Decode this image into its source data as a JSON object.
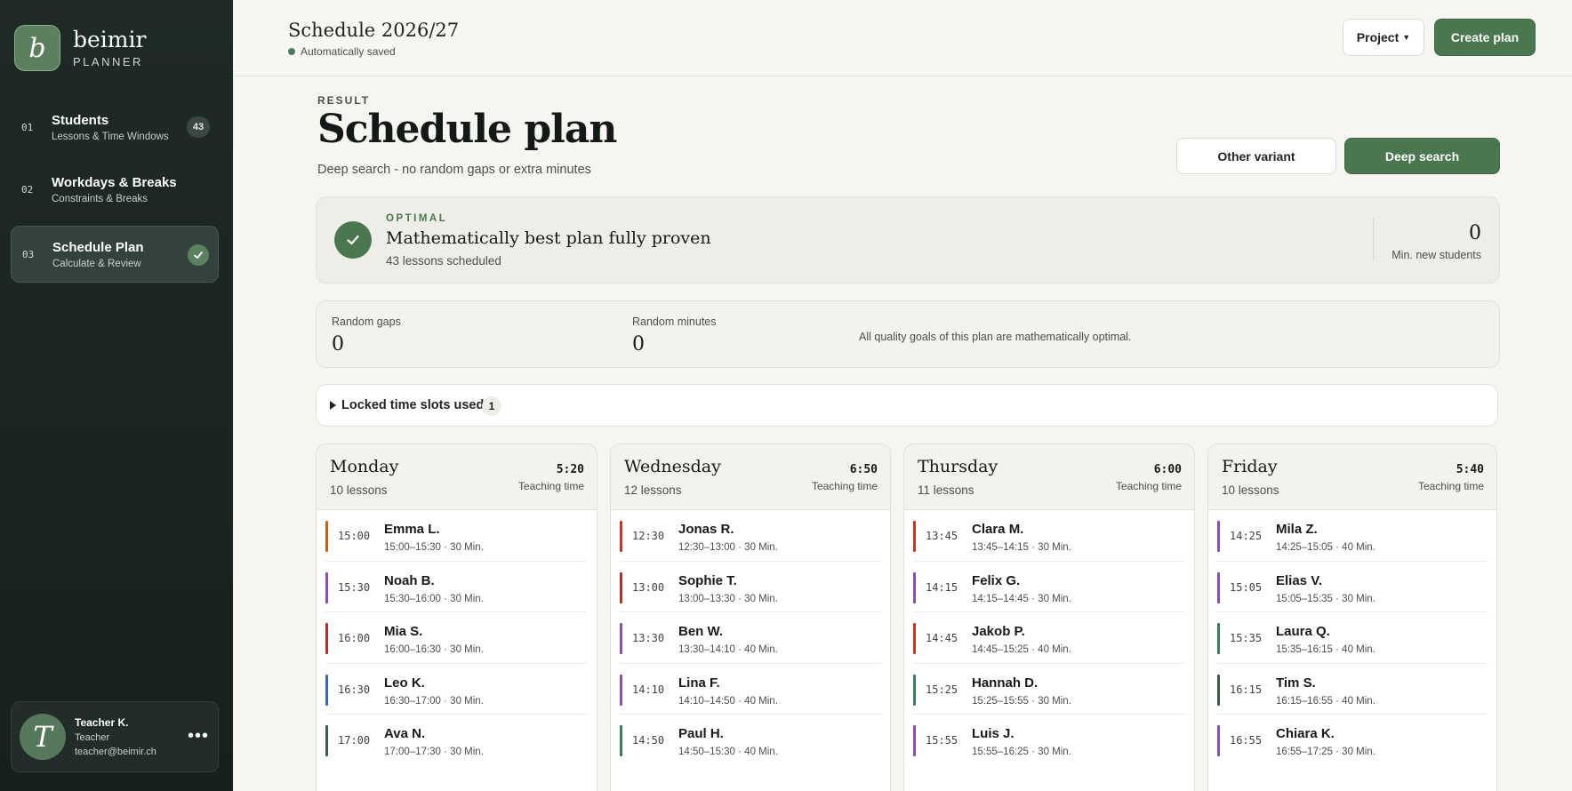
{
  "brand": {
    "logo_letter": "b",
    "name": "beimir",
    "sub": "PLANNER"
  },
  "sidebar": {
    "items": [
      {
        "num": "01",
        "title": "Students",
        "sub": "Lessons & Time Windows",
        "badge": "43"
      },
      {
        "num": "02",
        "title": "Workdays & Breaks",
        "sub": "Constraints & Breaks"
      },
      {
        "num": "03",
        "title": "Schedule Plan",
        "sub": "Calculate & Review",
        "status": "check-icon"
      }
    ],
    "user": {
      "initial": "T",
      "name": "Teacher K.",
      "role": "Teacher",
      "email": "teacher@beimir.ch",
      "more": "•••"
    }
  },
  "header": {
    "title": "Schedule 2026/27",
    "saved": "Automatically saved",
    "project_label": "Project",
    "create_label": "Create plan"
  },
  "main": {
    "kicker": "RESULT",
    "title": "Schedule plan",
    "subtitle": "Deep search - no random gaps or extra minutes",
    "other_variant_label": "Other variant",
    "deep_search_label": "Deep search",
    "optimal": {
      "kicker": "OPTIMAL",
      "title": "Mathematically best plan fully proven",
      "sub": "43 lessons scheduled",
      "value": "0",
      "value_label": "Min. new students"
    },
    "stats": {
      "gaps_label": "Random gaps",
      "gaps_value": "0",
      "minutes_label": "Random minutes",
      "minutes_value": "0",
      "note": "All quality goals of this plan are mathematically optimal."
    },
    "locked": {
      "label": "Locked time slots used",
      "count": "1"
    },
    "teaching_time_label": "Teaching time",
    "days": [
      {
        "name": "Monday",
        "count": "10 lessons",
        "time": "5:20",
        "lessons": [
          {
            "time": "15:00",
            "name": "Emma L.",
            "sub": "15:00–15:30 · 30 Min.",
            "color": "#b8651f"
          },
          {
            "time": "15:30",
            "name": "Noah B.",
            "sub": "15:30–16:00 · 30 Min.",
            "color": "#8a4fa8"
          },
          {
            "time": "16:00",
            "name": "Mia S.",
            "sub": "16:00–16:30 · 30 Min.",
            "color": "#a8332b"
          },
          {
            "time": "16:30",
            "name": "Leo K.",
            "sub": "16:30–17:00 · 30 Min.",
            "color": "#3f66b0"
          },
          {
            "time": "17:00",
            "name": "Ava N.",
            "sub": "17:00–17:30 · 30 Min.",
            "color": "#3f5a4a"
          }
        ]
      },
      {
        "name": "Wednesday",
        "count": "12 lessons",
        "time": "6:50",
        "lessons": [
          {
            "time": "12:30",
            "name": "Jonas R.",
            "sub": "12:30–13:00 · 30 Min.",
            "color": "#c0392b"
          },
          {
            "time": "13:00",
            "name": "Sophie T.",
            "sub": "13:00–13:30 · 30 Min.",
            "color": "#a8332b"
          },
          {
            "time": "13:30",
            "name": "Ben W.",
            "sub": "13:30–14:10 · 40 Min.",
            "color": "#8a4fa8"
          },
          {
            "time": "14:10",
            "name": "Lina F.",
            "sub": "14:10–14:50 · 40 Min.",
            "color": "#8a4fa8"
          },
          {
            "time": "14:50",
            "name": "Paul H.",
            "sub": "14:50–15:30 · 40 Min.",
            "color": "#3f7a5a"
          }
        ]
      },
      {
        "name": "Thursday",
        "count": "11 lessons",
        "time": "6:00",
        "lessons": [
          {
            "time": "13:45",
            "name": "Clara M.",
            "sub": "13:45–14:15 · 30 Min.",
            "color": "#c0392b"
          },
          {
            "time": "14:15",
            "name": "Felix G.",
            "sub": "14:15–14:45 · 30 Min.",
            "color": "#8a4fa8"
          },
          {
            "time": "14:45",
            "name": "Jakob P.",
            "sub": "14:45–15:25 · 40 Min.",
            "color": "#c0392b"
          },
          {
            "time": "15:25",
            "name": "Hannah D.",
            "sub": "15:25–15:55 · 30 Min.",
            "color": "#3f7a5a"
          },
          {
            "time": "15:55",
            "name": "Luis J.",
            "sub": "15:55–16:25 · 30 Min.",
            "color": "#8a4fa8"
          }
        ]
      },
      {
        "name": "Friday",
        "count": "10 lessons",
        "time": "5:40",
        "lessons": [
          {
            "time": "14:25",
            "name": "Mila Z.",
            "sub": "14:25–15:05 · 40 Min.",
            "color": "#8a4fa8"
          },
          {
            "time": "15:05",
            "name": "Elias V.",
            "sub": "15:05–15:35 · 30 Min.",
            "color": "#8a4fa8"
          },
          {
            "time": "15:35",
            "name": "Laura Q.",
            "sub": "15:35–16:15 · 40 Min.",
            "color": "#3f7a5a"
          },
          {
            "time": "16:15",
            "name": "Tim S.",
            "sub": "16:15–16:55 · 40 Min.",
            "color": "#3f5a4a"
          },
          {
            "time": "16:55",
            "name": "Chiara K.",
            "sub": "16:55–17:25 · 30 Min.",
            "color": "#8a4fa8"
          }
        ]
      }
    ]
  },
  "colors": {
    "accent": "#4a7650",
    "sidebar_bg": "#1f2a26",
    "page_bg": "#f6f5f1"
  }
}
